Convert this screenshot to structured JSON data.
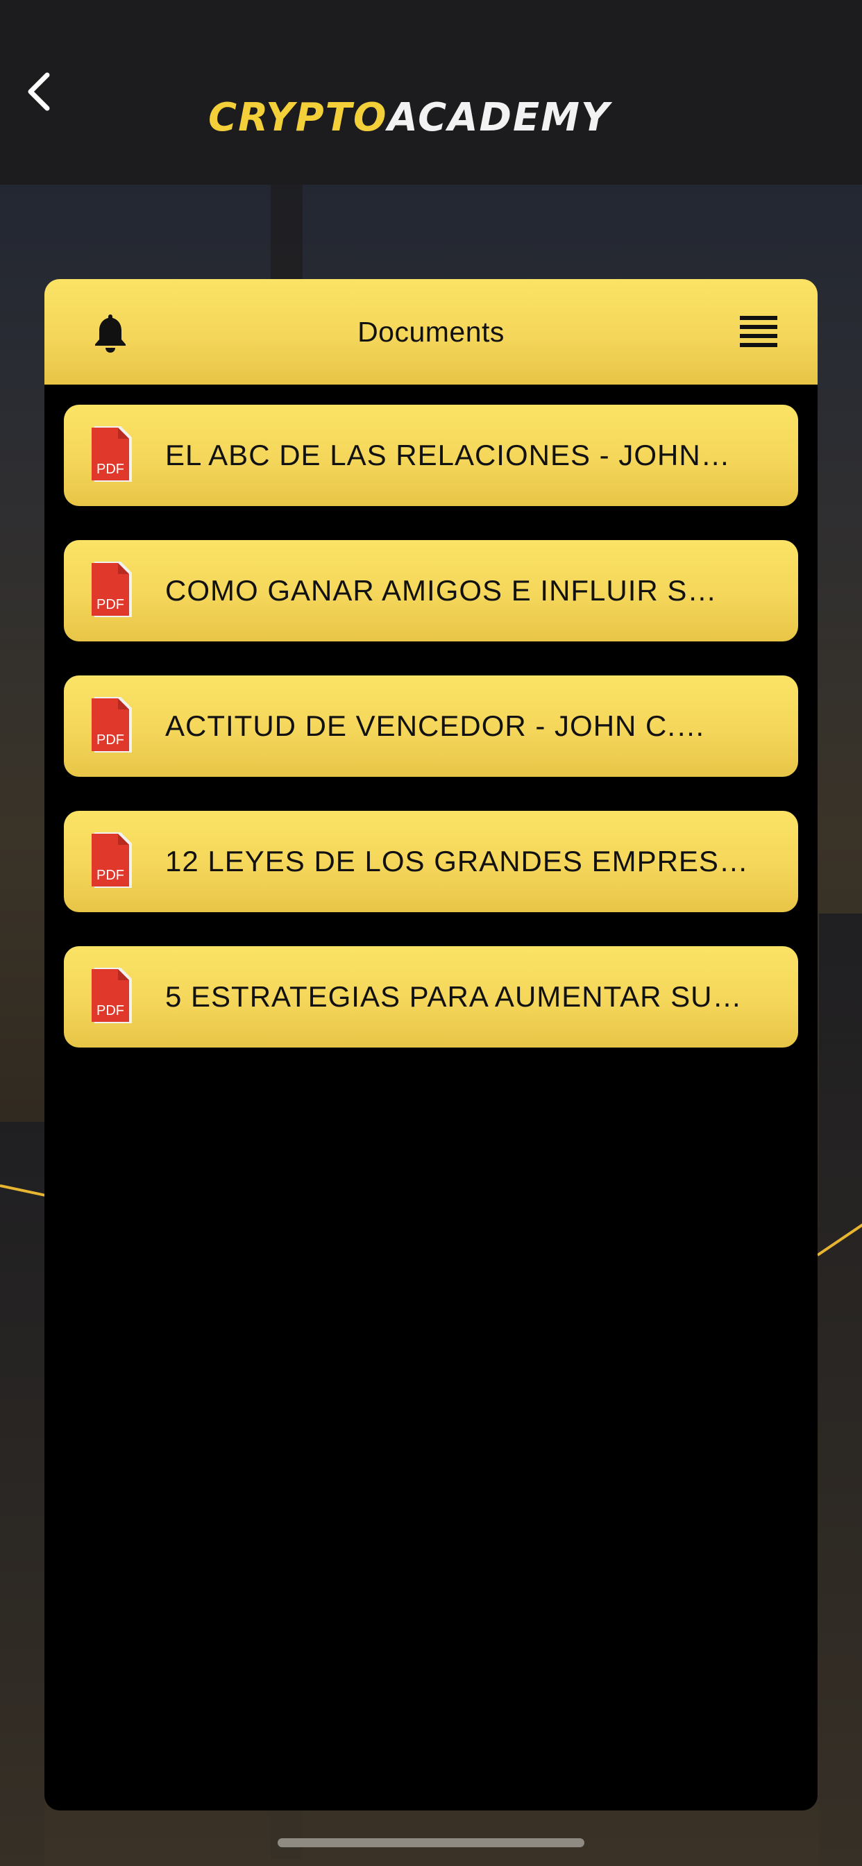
{
  "header": {
    "logo_part1": "CRYPTO",
    "logo_part2": "ACADEMY"
  },
  "panel": {
    "title": "Documents"
  },
  "documents": [
    {
      "label": "EL ABC DE LAS RELACIONES - JOHN…",
      "icon": "pdf-icon"
    },
    {
      "label": "COMO GANAR AMIGOS E INFLUIR S…",
      "icon": "pdf-icon"
    },
    {
      "label": "ACTITUD DE VENCEDOR - JOHN C.…",
      "icon": "pdf-icon"
    },
    {
      "label": "12 LEYES DE LOS GRANDES EMPRES…",
      "icon": "pdf-icon"
    },
    {
      "label": "5 ESTRATEGIAS PARA AUMENTAR SU…",
      "icon": "pdf-icon"
    }
  ],
  "pdf_badge": "PDF",
  "colors": {
    "accent_yellow": "#f4d65a",
    "logo_yellow": "#f3cf3a",
    "pdf_red": "#e0392b",
    "header_dark": "#1c1c1e"
  }
}
